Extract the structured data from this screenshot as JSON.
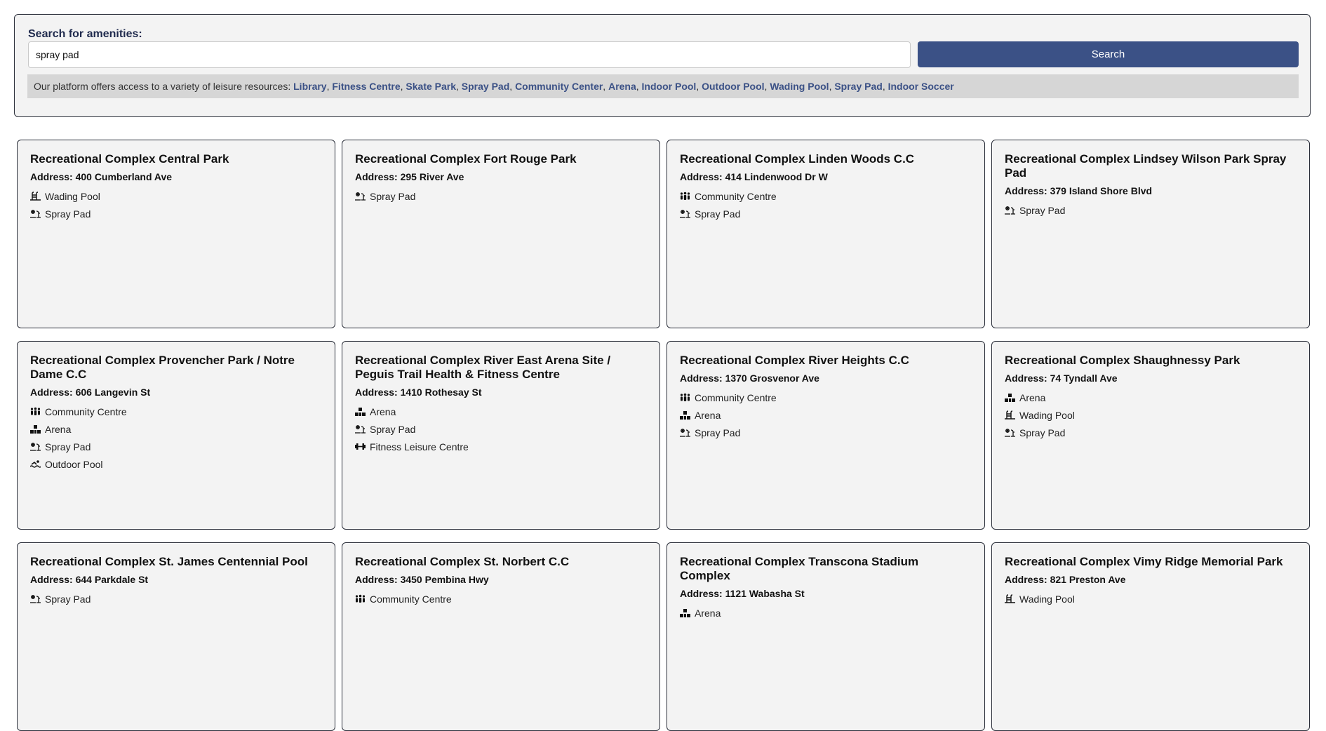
{
  "search": {
    "label": "Search for amenities:",
    "value": "spray pad",
    "button_label": "Search"
  },
  "resources": {
    "intro": "Our platform offers access to a variety of leisure resources: ",
    "items": [
      "Library",
      "Fitness Centre",
      "Skate Park",
      "Spray Pad",
      "Community Center",
      "Arena",
      "Indoor Pool",
      "Outdoor Pool",
      "Wading Pool",
      "Spray Pad",
      "Indoor Soccer"
    ]
  },
  "cards": [
    {
      "title": "Recreational Complex Central Park",
      "address": "Address: 400 Cumberland Ave",
      "amenities": [
        {
          "icon": "wading-pool-icon",
          "label": "Wading Pool"
        },
        {
          "icon": "spray-pad-icon",
          "label": "Spray Pad"
        }
      ]
    },
    {
      "title": "Recreational Complex Fort Rouge Park",
      "address": "Address: 295 River Ave",
      "amenities": [
        {
          "icon": "spray-pad-icon",
          "label": "Spray Pad"
        }
      ]
    },
    {
      "title": "Recreational Complex Linden Woods C.C",
      "address": "Address: 414 Lindenwood Dr W",
      "amenities": [
        {
          "icon": "community-centre-icon",
          "label": "Community Centre"
        },
        {
          "icon": "spray-pad-icon",
          "label": "Spray Pad"
        }
      ]
    },
    {
      "title": "Recreational Complex Lindsey Wilson Park Spray Pad",
      "address": "Address: 379 Island Shore Blvd",
      "amenities": [
        {
          "icon": "spray-pad-icon",
          "label": "Spray Pad"
        }
      ]
    },
    {
      "title": "Recreational Complex Provencher Park / Notre Dame C.C",
      "address": "Address: 606 Langevin St",
      "amenities": [
        {
          "icon": "community-centre-icon",
          "label": "Community Centre"
        },
        {
          "icon": "arena-icon",
          "label": "Arena"
        },
        {
          "icon": "spray-pad-icon",
          "label": "Spray Pad"
        },
        {
          "icon": "outdoor-pool-icon",
          "label": "Outdoor Pool"
        }
      ]
    },
    {
      "title": "Recreational Complex River East Arena Site / Peguis Trail Health & Fitness Centre",
      "address": "Address: 1410 Rothesay St",
      "amenities": [
        {
          "icon": "arena-icon",
          "label": "Arena"
        },
        {
          "icon": "spray-pad-icon",
          "label": "Spray Pad"
        },
        {
          "icon": "dumbbell-icon",
          "label": "Fitness Leisure Centre"
        }
      ]
    },
    {
      "title": "Recreational Complex River Heights C.C",
      "address": "Address: 1370 Grosvenor Ave",
      "amenities": [
        {
          "icon": "community-centre-icon",
          "label": "Community Centre"
        },
        {
          "icon": "arena-icon",
          "label": "Arena"
        },
        {
          "icon": "spray-pad-icon",
          "label": "Spray Pad"
        }
      ]
    },
    {
      "title": "Recreational Complex Shaughnessy Park",
      "address": "Address: 74 Tyndall Ave",
      "amenities": [
        {
          "icon": "arena-icon",
          "label": "Arena"
        },
        {
          "icon": "wading-pool-icon",
          "label": "Wading Pool"
        },
        {
          "icon": "spray-pad-icon",
          "label": "Spray Pad"
        }
      ]
    },
    {
      "title": "Recreational Complex St. James Centennial Pool",
      "address": "Address: 644 Parkdale St",
      "amenities": [
        {
          "icon": "spray-pad-icon",
          "label": "Spray Pad"
        }
      ]
    },
    {
      "title": "Recreational Complex St. Norbert C.C",
      "address": "Address: 3450 Pembina Hwy",
      "amenities": [
        {
          "icon": "community-centre-icon",
          "label": "Community Centre"
        }
      ]
    },
    {
      "title": "Recreational Complex Transcona Stadium Complex",
      "address": "Address: 1121 Wabasha St",
      "amenities": [
        {
          "icon": "arena-icon",
          "label": "Arena"
        }
      ]
    },
    {
      "title": "Recreational Complex Vimy Ridge Memorial Park",
      "address": "Address: 821 Preston Ave",
      "amenities": [
        {
          "icon": "wading-pool-icon",
          "label": "Wading Pool"
        }
      ]
    }
  ]
}
